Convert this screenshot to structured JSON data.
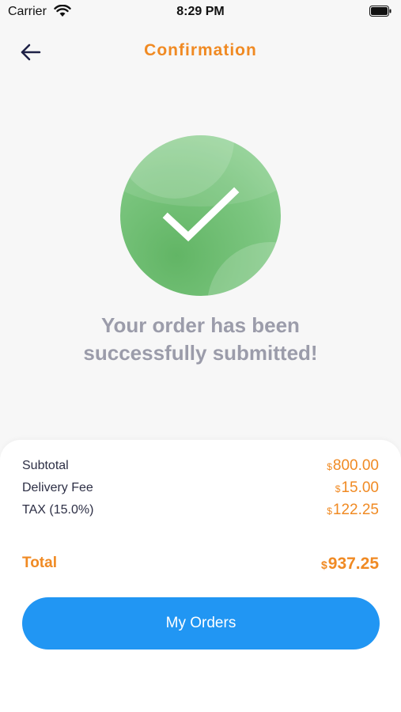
{
  "status_bar": {
    "carrier": "Carrier",
    "time": "8:29 PM",
    "icons": [
      "wifi-icon",
      "battery-icon"
    ]
  },
  "header": {
    "title": "Confirmation",
    "back_icon": "arrow-left-icon"
  },
  "success": {
    "icon": "checkmark-icon",
    "circle_color": "#7cc680",
    "message_line1": "Your order has been",
    "message_line2": "successfully submitted!"
  },
  "summary": {
    "currency": "$",
    "rows": [
      {
        "label": "Subtotal",
        "amount": "800.00"
      },
      {
        "label": "Delivery Fee",
        "amount": "15.00"
      },
      {
        "label": "TAX (15.0%)",
        "amount": "122.25"
      }
    ],
    "total": {
      "label": "Total",
      "amount": "937.25"
    }
  },
  "actions": {
    "my_orders_label": "My Orders"
  },
  "colors": {
    "accent": "#f08a23",
    "primary_button": "#2196f3",
    "message_text": "#9b9caa"
  }
}
